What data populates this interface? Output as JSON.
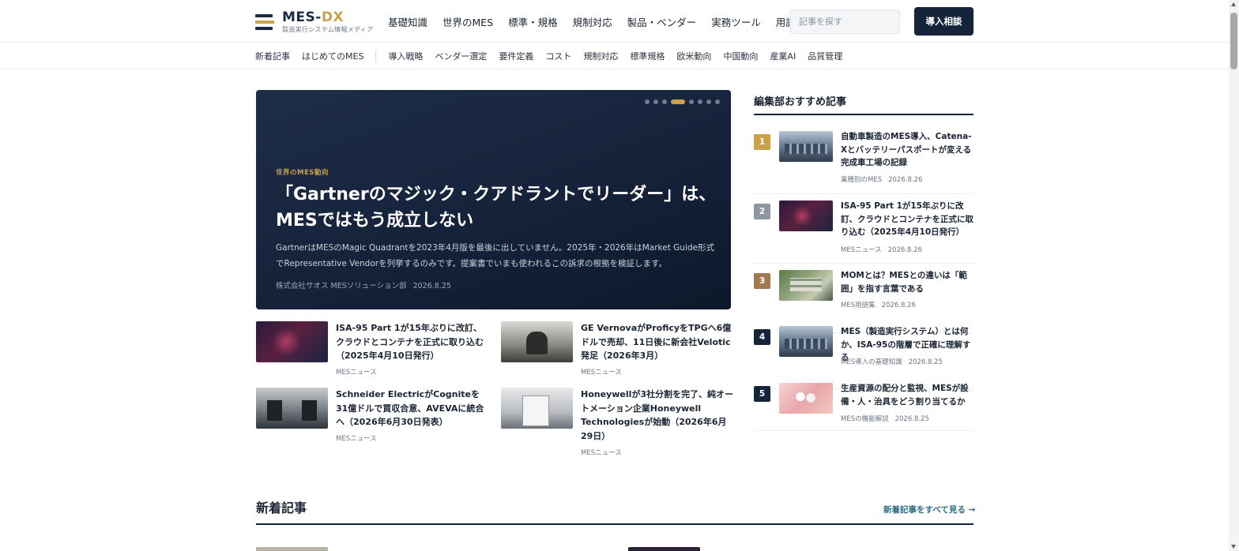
{
  "header": {
    "logo_main": "MES-",
    "logo_accent": "DX",
    "logo_sub": "製造実行システム情報メディア",
    "nav": [
      "基礎知識",
      "世界のMES",
      "標準・規格",
      "規制対応",
      "製品・ベンダー",
      "実務ツール",
      "用語集"
    ],
    "search_placeholder": "記事を探す",
    "cta_label": "導入相談"
  },
  "subnav": {
    "primary": [
      "新着記事",
      "はじめてのMES"
    ],
    "secondary": [
      "導入戦略",
      "ベンダー選定",
      "要件定義",
      "コスト",
      "規制対応",
      "標準規格",
      "欧米動向",
      "中国動向",
      "産業AI",
      "品質管理"
    ]
  },
  "hero": {
    "category": "世界のMES動向",
    "title": "「Gartnerのマジック・クアドラントでリーダー」は、MESではもう成立しない",
    "description": "GartnerはMESのMagic Quadrantを2023年4月版を最後に出していません。2025年・2026年はMarket Guide形式でRepresentative Vendorを列挙するのみです。提案書でいまも使われるこの訴求の根拠を検証します。",
    "author": "株式会社サオス MESソリューション部",
    "date": "2026.8.25",
    "slide_count": 8,
    "active_slide": 4
  },
  "articles": [
    {
      "title": "ISA-95 Part 1が15年ぶりに改訂、クラウドとコンテナを正式に取り込む（2025年4月10日発行）",
      "tag": "MESニュース",
      "icon": "dark-keyboard-photo"
    },
    {
      "title": "GE VernovaがProficyをTPGへ6億ドルで売却、11日後に新会社Velotic発足（2026年3月）",
      "tag": "MESニュース",
      "icon": "office-worker-photo"
    },
    {
      "title": "Schneider ElectricがCogniteを31億ドルで買収合意、AVEVAに統合へ（2026年6月30日発表）",
      "tag": "MESニュース",
      "icon": "business-meeting-photo"
    },
    {
      "title": "Honeywellが3社分割を完了、純オートメーション企業Honeywell Technologiesが始動（2026年6月29日）",
      "tag": "MESニュース",
      "icon": "document-review-photo"
    }
  ],
  "sidebar": {
    "title": "編集部おすすめ記事",
    "items": [
      {
        "rank": "1",
        "title": "自動車製造のMES導入、Catena-Xとバッテリーパスポートが変える完成車工場の記録",
        "tag": "業種別のMES",
        "date": "2026.8.26",
        "color": "#c9a24a"
      },
      {
        "rank": "2",
        "title": "ISA-95 Part 1が15年ぶりに改訂、クラウドとコンテナを正式に取り込む（2025年4月10日発行）",
        "tag": "MESニュース",
        "date": "2026.8.26",
        "color": "#8e96a3"
      },
      {
        "rank": "3",
        "title": "MOMとは？MESとの違いは「範囲」を指す言葉である",
        "tag": "MES用語集",
        "date": "2026.8.26",
        "color": "#a07a4f"
      },
      {
        "rank": "4",
        "title": "MES（製造実行システム）とは何か、ISA-95の階層で正確に理解する",
        "tag": "MES導入の基礎知識",
        "date": "2026.8.25",
        "color": "#15233b"
      },
      {
        "rank": "5",
        "title": "生産資源の配分と監視、MESが設備・人・治具をどう割り当てるか",
        "tag": "MESの機能解説",
        "date": "2026.8.25",
        "color": "#15233b"
      }
    ]
  },
  "new_section": {
    "title": "新着記事",
    "more_link": "新着記事をすべて見る →"
  }
}
